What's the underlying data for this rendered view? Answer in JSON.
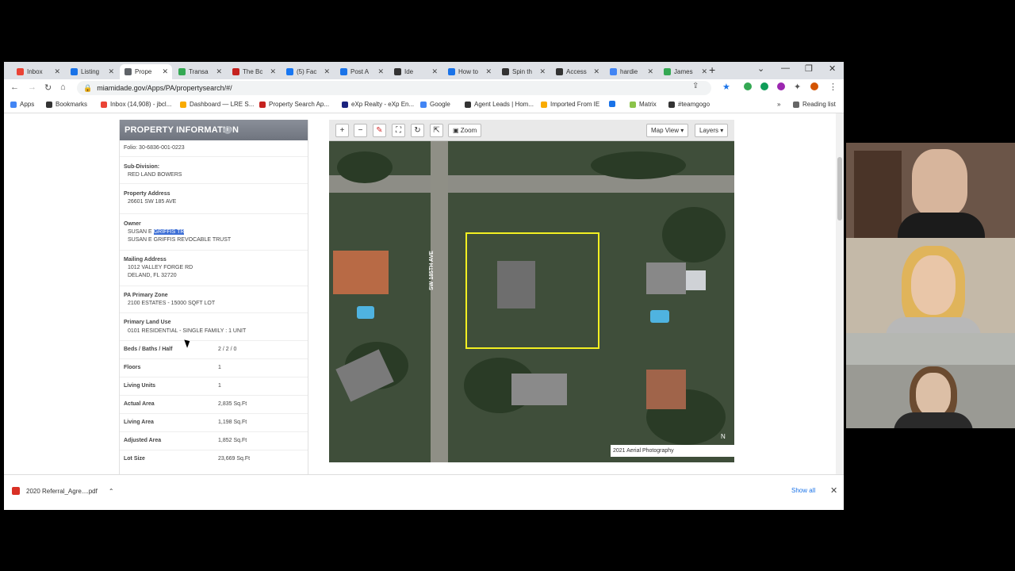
{
  "tabs": [
    {
      "label": "Inbox",
      "color": "#ea4335"
    },
    {
      "label": "Listing",
      "color": "#1a73e8"
    },
    {
      "label": "Prope",
      "color": "#5f6368",
      "active": true
    },
    {
      "label": "Transa",
      "color": "#34a853"
    },
    {
      "label": "The Bc",
      "color": "#c5221f"
    },
    {
      "label": "(5) Fac",
      "color": "#1877f2"
    },
    {
      "label": "Post A",
      "color": "#1a73e8"
    },
    {
      "label": "Ide",
      "color": "#333"
    },
    {
      "label": "How to",
      "color": "#1a73e8"
    },
    {
      "label": "Spin th",
      "color": "#333"
    },
    {
      "label": "Access",
      "color": "#333"
    },
    {
      "label": "hardie",
      "color": "#4285f4"
    },
    {
      "label": "James",
      "color": "#34a853"
    }
  ],
  "address_bar": {
    "url": "miamidade.gov/Apps/PA/propertysearch/#/"
  },
  "bookmarks": [
    {
      "label": "Apps",
      "color": "#4285f4"
    },
    {
      "label": "Bookmarks",
      "color": "#333"
    },
    {
      "label": "Inbox (14,908) - jbcl...",
      "color": "#ea4335"
    },
    {
      "label": "Dashboard — LRE S...",
      "color": "#f9ab00"
    },
    {
      "label": "Property Search Ap...",
      "color": "#c5221f"
    },
    {
      "label": "eXp Realty - eXp En...",
      "color": "#1a237e"
    },
    {
      "label": "Google",
      "color": "#4285f4"
    },
    {
      "label": "Agent Leads | Hom...",
      "color": "#333"
    },
    {
      "label": "Imported From IE",
      "color": "#f9ab00"
    },
    {
      "label": "",
      "color": "#1a73e8"
    },
    {
      "label": "Matrix",
      "color": "#8bc34a"
    },
    {
      "label": "#teamgogo",
      "color": "#333"
    }
  ],
  "reading_list": "Reading list",
  "property_panel": {
    "title": "PROPERTY INFORMATION",
    "folio": "Folio: 30-6836-001-0223",
    "subdivision_label": "Sub-Division:",
    "subdivision_value": "RED LAND BOWERS",
    "address_label": "Property Address",
    "address_value": "26601 SW 185 AVE",
    "owner_label": "Owner",
    "owner_line1_a": "SUSAN E",
    "owner_line1_b": "GRIFFIS TR",
    "owner_line2": "SUSAN E GRIFFIS REVOCABLE TRUST",
    "mailing_label": "Mailing Address",
    "mailing_line1": "1012 VALLEY FORGE RD",
    "mailing_line2": "DELAND, FL 32720",
    "zone_label": "PA Primary Zone",
    "zone_value": "2100 ESTATES - 15000 SQFT LOT",
    "use_label": "Primary Land Use",
    "use_value": "0101 RESIDENTIAL - SINGLE FAMILY : 1 UNIT",
    "rows": [
      {
        "label": "Beds / Baths / Half",
        "value": "2 / 2 / 0"
      },
      {
        "label": "Floors",
        "value": "1"
      },
      {
        "label": "Living Units",
        "value": "1"
      },
      {
        "label": "Actual Area",
        "value": "2,835 Sq.Ft"
      },
      {
        "label": "Living Area",
        "value": "1,198 Sq.Ft"
      },
      {
        "label": "Adjusted Area",
        "value": "1,852 Sq.Ft"
      },
      {
        "label": "Lot Size",
        "value": "23,669 Sq.Ft"
      }
    ]
  },
  "map": {
    "zoom_label": "Zoom",
    "map_view_label": "Map View",
    "layers_label": "Layers",
    "street_label": "SW 185TH AVE",
    "legend": "2021 Aerial Photography",
    "north": "N"
  },
  "downloads": {
    "file": "2020 Referral_Agre....pdf",
    "show_all": "Show all"
  }
}
